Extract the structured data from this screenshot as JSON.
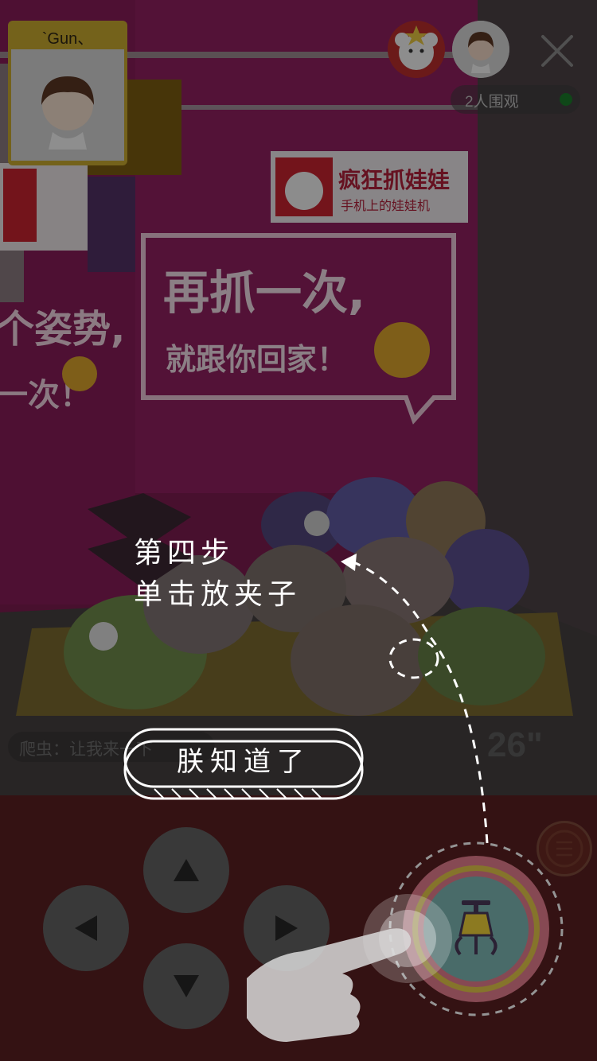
{
  "player": {
    "name": "`Gun、"
  },
  "viewers": {
    "count_text": "2人围观"
  },
  "room": {
    "logo_title": "疯狂抓娃娃",
    "logo_sub": "手机上的娃娃机",
    "sign_line1": "再抓一次,",
    "sign_line2": "就跟你回家！",
    "left_sign_line1": "个姿势,",
    "left_sign_line2": "一次！"
  },
  "chat": {
    "message": "爬虫：让我来一下"
  },
  "timer": "26\"",
  "tutorial": {
    "step_title": "第四步",
    "step_desc": "单击放夹子",
    "confirm_label": "朕知道了"
  },
  "icons": {
    "close": "close-icon",
    "up": "arrow-up-icon",
    "down": "arrow-down-icon",
    "left": "arrow-left-icon",
    "right": "arrow-right-icon",
    "menu": "menu-icon",
    "grab": "claw-icon",
    "hand": "pointing-hand-icon"
  },
  "colors": {
    "booth_pink": "#c4267e",
    "panel_bg": "#5b1f22",
    "dpad": "#636363",
    "grab_teal": "#7fb8b5",
    "grab_ring_pink": "#e77f8f",
    "grab_ring_yellow": "#e6c84a"
  }
}
